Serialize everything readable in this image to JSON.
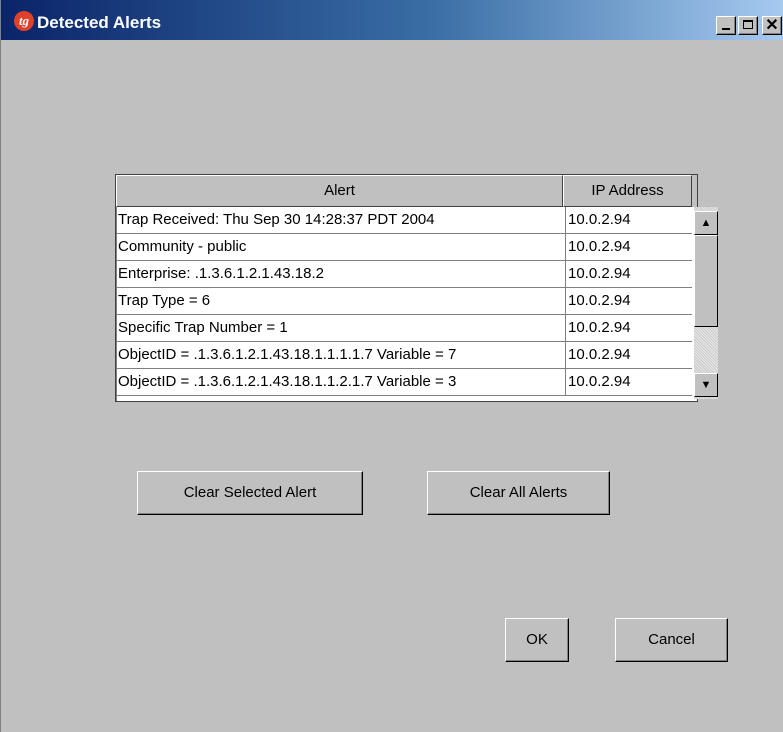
{
  "window": {
    "title": "Detected Alerts",
    "app_icon_text": "tg",
    "controls": {
      "minimize": "minimize-icon",
      "maximize": "maximize-icon",
      "close": "close-icon",
      "close_glyph": "✕"
    }
  },
  "table": {
    "headers": {
      "alert": "Alert",
      "ip": "IP Address"
    },
    "rows": [
      {
        "alert": "Trap Received: Thu Sep 30 14:28:37 PDT 2004",
        "ip": "10.0.2.94"
      },
      {
        "alert": "Community - public",
        "ip": "10.0.2.94"
      },
      {
        "alert": "Enterprise: .1.3.6.1.2.1.43.18.2",
        "ip": "10.0.2.94"
      },
      {
        "alert": "Trap Type = 6",
        "ip": "10.0.2.94"
      },
      {
        "alert": "Specific Trap Number = 1",
        "ip": "10.0.2.94"
      },
      {
        "alert": "ObjectID = .1.3.6.1.2.1.43.18.1.1.1.1.7 Variable = 7",
        "ip": "10.0.2.94"
      },
      {
        "alert": "ObjectID = .1.3.6.1.2.1.43.18.1.1.2.1.7 Variable = 3",
        "ip": "10.0.2.94"
      }
    ],
    "scrollbar": {
      "up_glyph": "▲",
      "down_glyph": "▼"
    }
  },
  "buttons": {
    "clear_selected": "Clear Selected Alert",
    "clear_all": "Clear All Alerts",
    "ok": "OK",
    "cancel": "Cancel"
  },
  "colors": {
    "titlebar_start": "#0a246a",
    "titlebar_end": "#a6caf0",
    "dialog_bg": "#c0c0c0",
    "table_bg": "#ffffff"
  }
}
